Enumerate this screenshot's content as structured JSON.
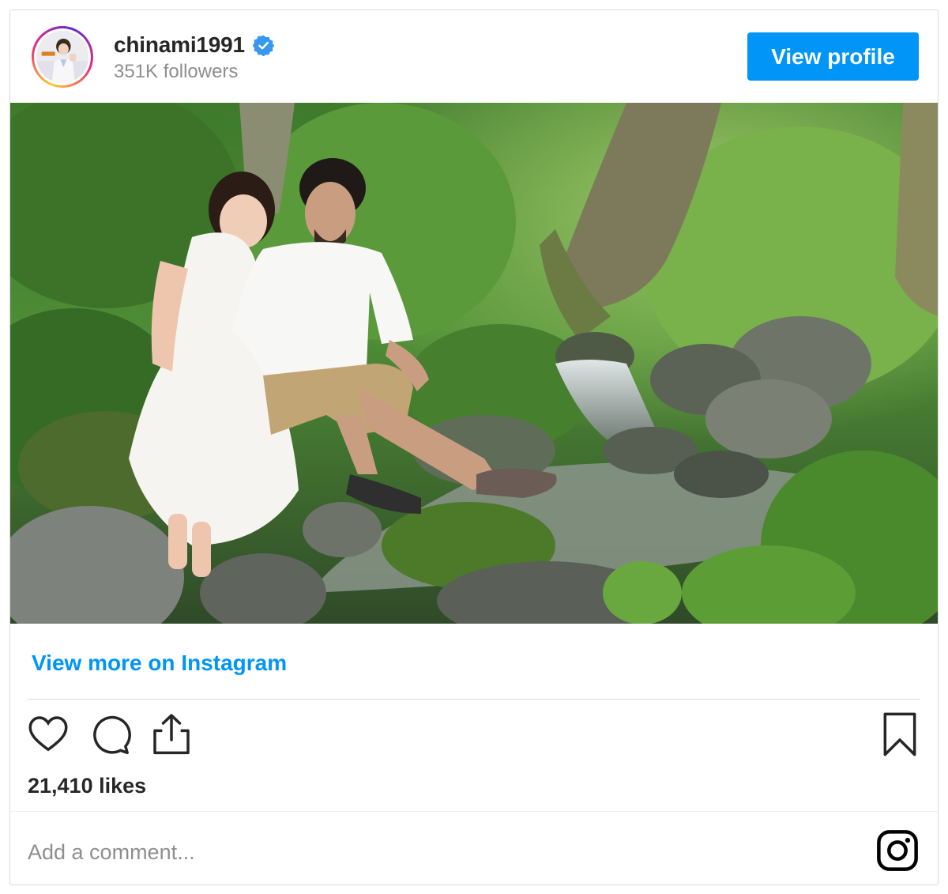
{
  "header": {
    "username": "chinami1991",
    "followers": "351K followers",
    "view_profile_label": "View profile",
    "verified_color": "#3897f0"
  },
  "post": {
    "view_more_label": "View more on Instagram",
    "likes": "21,410 likes"
  },
  "comment": {
    "placeholder": "Add a comment..."
  },
  "icons": {
    "like": "heart-icon",
    "comment": "comment-bubble-icon",
    "share": "share-icon",
    "save": "bookmark-icon",
    "brand": "instagram-logo-icon"
  },
  "colors": {
    "accent": "#0095f6",
    "text": "#262626",
    "muted": "#8e8e8e",
    "border": "#dbdbdb"
  }
}
